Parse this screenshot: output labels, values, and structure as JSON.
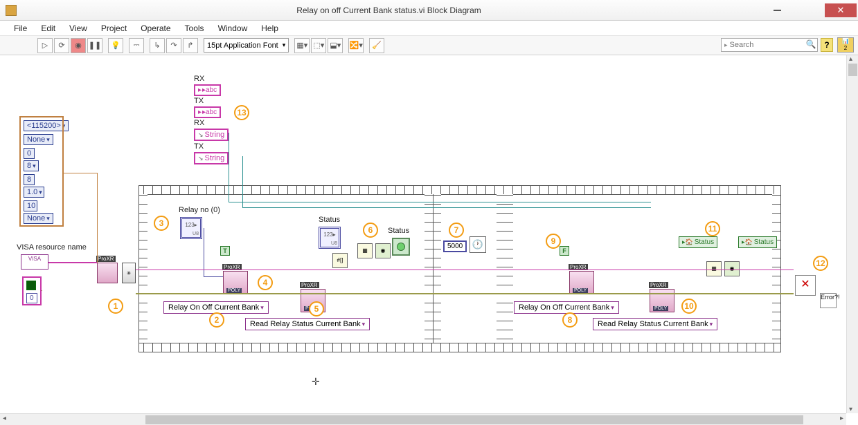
{
  "window": {
    "title": "Relay on off Current Bank status.vi Block Diagram",
    "app_icon_label": "VI"
  },
  "menu": [
    "File",
    "Edit",
    "View",
    "Project",
    "Operate",
    "Tools",
    "Window",
    "Help"
  ],
  "toolbar": {
    "font": "15pt Application Font",
    "search_placeholder": "Search"
  },
  "constants": {
    "baud": "<115200>",
    "parity_none": "None",
    "databits": "0",
    "eight": "8",
    "eightb": "8",
    "flow": "1.0",
    "ten": "10",
    "none2": "None",
    "visa_label": "VISA resource name",
    "fconst": "0",
    "waitms": "5000"
  },
  "labels": {
    "rx1": "RX",
    "tx1": "TX",
    "rx2": "RX",
    "tx2": "TX",
    "string1": "String",
    "string2": "String",
    "relayno": "Relay no (0)",
    "status_ctrl": "Status",
    "status_ind": "Status",
    "localvar1": "Status",
    "localvar2": "Status",
    "abc": "▸abc",
    "visa_text": "VISA"
  },
  "polysels": {
    "relay_onoff1": "Relay On Off Current Bank",
    "read_status1": "Read Relay Status Current Bank",
    "relay_onoff2": "Relay On Off Current Bank",
    "read_status2": "Read Relay Status Current Bank"
  },
  "bools": {
    "true": "T",
    "false": "F"
  },
  "subvi": {
    "proxr": "ProXR",
    "poly": "POLY"
  },
  "callouts": [
    "1",
    "2",
    "3",
    "4",
    "5",
    "6",
    "7",
    "8",
    "9",
    "10",
    "11",
    "12",
    "13"
  ],
  "error": {
    "x": "✕",
    "qmk": "Error?!"
  },
  "numctrl_inner": "123▸"
}
